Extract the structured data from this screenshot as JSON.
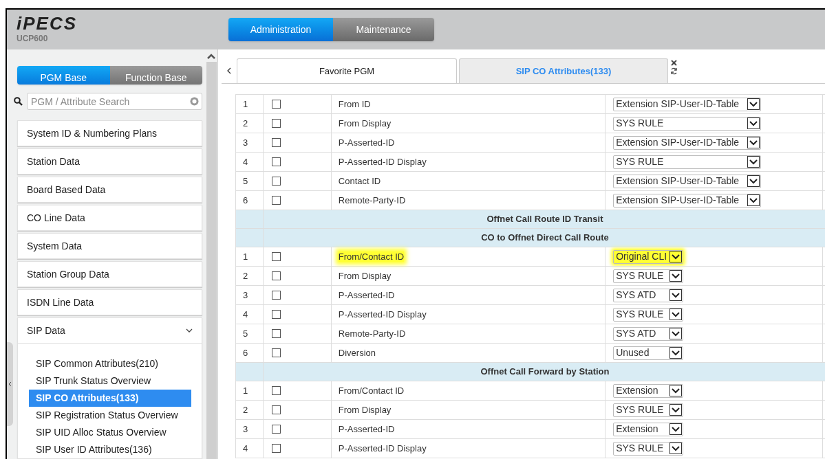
{
  "header": {
    "logo": "iPECS",
    "model": "UCP600",
    "modes": [
      {
        "label": "Administration",
        "selected": true
      },
      {
        "label": "Maintenance",
        "selected": false
      }
    ]
  },
  "sidebar": {
    "bases": [
      {
        "label": "PGM Base",
        "selected": true
      },
      {
        "label": "Function Base",
        "selected": false
      }
    ],
    "search": {
      "placeholder": "PGM / Attribute Search"
    },
    "groups": [
      {
        "label": "System ID & Numbering Plans",
        "expanded": false
      },
      {
        "label": "Station Data",
        "expanded": false
      },
      {
        "label": "Board Based Data",
        "expanded": false
      },
      {
        "label": "CO Line Data",
        "expanded": false
      },
      {
        "label": "System Data",
        "expanded": false
      },
      {
        "label": "Station Group Data",
        "expanded": false
      },
      {
        "label": "ISDN Line Data",
        "expanded": false
      },
      {
        "label": "SIP Data",
        "expanded": true,
        "children": [
          {
            "label": "SIP Common Attributes(210)",
            "selected": false
          },
          {
            "label": "SIP Trunk Status Overview",
            "selected": false
          },
          {
            "label": "SIP CO Attributes(133)",
            "selected": true
          },
          {
            "label": "SIP Registration Status Overview",
            "selected": false
          },
          {
            "label": "SIP UID Alloc Status Overview",
            "selected": false
          },
          {
            "label": "SIP User ID Attributes(136)",
            "selected": false
          }
        ]
      }
    ]
  },
  "tabs": [
    {
      "label": "Favorite PGM",
      "selected": false
    },
    {
      "label": "SIP CO Attributes(133)",
      "selected": true
    }
  ],
  "sections": [
    {
      "rows": [
        {
          "no": "1",
          "checked": false,
          "label": "From ID",
          "value": "Extension SIP-User-ID-Table",
          "highlighted": false
        },
        {
          "no": "2",
          "checked": false,
          "label": "From Display",
          "value": "SYS RULE",
          "highlighted": false
        },
        {
          "no": "3",
          "checked": false,
          "label": "P-Asserted-ID",
          "value": "Extension SIP-User-ID-Table",
          "highlighted": false
        },
        {
          "no": "4",
          "checked": false,
          "label": "P-Asserted-ID Display",
          "value": "SYS RULE",
          "highlighted": false
        },
        {
          "no": "5",
          "checked": false,
          "label": "Contact ID",
          "value": "Extension SIP-User-ID-Table",
          "highlighted": false
        },
        {
          "no": "6",
          "checked": false,
          "label": "Remote-Party-ID",
          "value": "Extension SIP-User-ID-Table",
          "highlighted": false
        }
      ]
    },
    {
      "title": "Offnet Call Route ID Transit"
    },
    {
      "title": "CO to Offnet Direct Call Route",
      "rows": [
        {
          "no": "1",
          "checked": false,
          "label": "From/Contact ID",
          "value": "Original CLI",
          "highlighted": true
        },
        {
          "no": "2",
          "checked": false,
          "label": "From Display",
          "value": "SYS RULE",
          "highlighted": false
        },
        {
          "no": "3",
          "checked": false,
          "label": "P-Asserted-ID",
          "value": "SYS ATD",
          "highlighted": false
        },
        {
          "no": "4",
          "checked": false,
          "label": "P-Asserted-ID Display",
          "value": "SYS RULE",
          "highlighted": false
        },
        {
          "no": "5",
          "checked": false,
          "label": "Remote-Party-ID",
          "value": "SYS ATD",
          "highlighted": false
        },
        {
          "no": "6",
          "checked": false,
          "label": "Diversion",
          "value": "Unused",
          "highlighted": false
        }
      ]
    },
    {
      "title": "Offnet Call Forward by Station",
      "rows": [
        {
          "no": "1",
          "checked": false,
          "label": "From/Contact ID",
          "value": "Extension",
          "highlighted": false
        },
        {
          "no": "2",
          "checked": false,
          "label": "From Display",
          "value": "SYS RULE",
          "highlighted": false
        },
        {
          "no": "3",
          "checked": false,
          "label": "P-Asserted-ID",
          "value": "Extension",
          "highlighted": false
        },
        {
          "no": "4",
          "checked": false,
          "label": "P-Asserted-ID Display",
          "value": "SYS RULE",
          "highlighted": false
        }
      ]
    }
  ]
}
